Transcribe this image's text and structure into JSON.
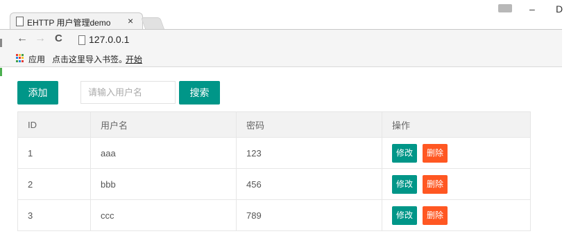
{
  "browser": {
    "tab": {
      "title": "EHTTP 用户管理demo",
      "close": "×"
    },
    "window_controls": {
      "minimize": "–",
      "close": "D"
    },
    "nav": {
      "back": "←",
      "forward": "→",
      "reload": "C"
    },
    "url": "127.0.0.1",
    "bookmarks": {
      "apps_label": "应用",
      "import_label": "点击这里导入书签。",
      "start_label": "开始"
    }
  },
  "page": {
    "add_label": "添加",
    "search_placeholder": "请输入用户名",
    "search_value": "",
    "search_label": "搜索",
    "table": {
      "headers": [
        "ID",
        "用户名",
        "密码",
        "操作"
      ],
      "rows": [
        {
          "id": "1",
          "name": "aaa",
          "password": "123"
        },
        {
          "id": "2",
          "name": "bbb",
          "password": "456"
        },
        {
          "id": "3",
          "name": "ccc",
          "password": "789"
        }
      ],
      "edit_label": "修改",
      "delete_label": "删除"
    }
  },
  "colors": {
    "primary": "#009688",
    "danger": "#ff5722",
    "header_bg": "#f2f2f2",
    "border": "#e6e6e6"
  },
  "icons": [
    "page-icon",
    "close-icon",
    "back-arrow-icon",
    "forward-arrow-icon",
    "reload-icon",
    "apps-grid-icon",
    "user-icon",
    "minimize-icon"
  ]
}
